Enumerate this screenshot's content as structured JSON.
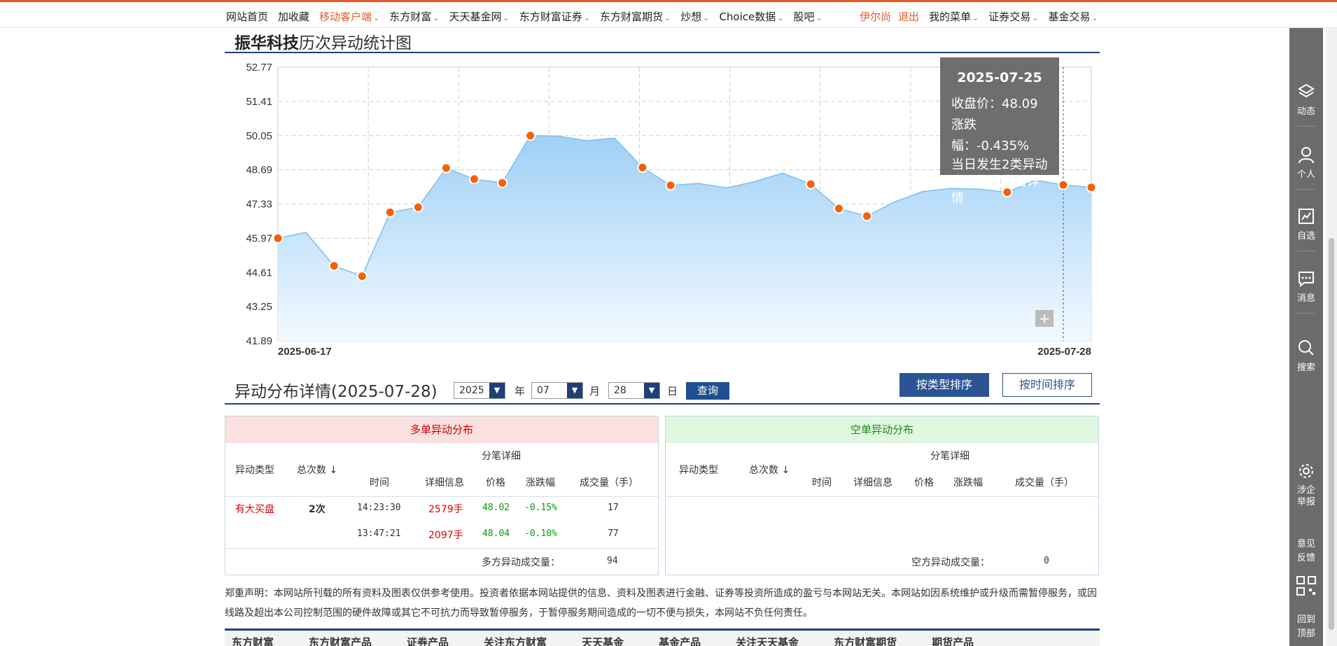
{
  "nav": {
    "left": [
      {
        "label": "网站首页",
        "orange": false,
        "caret": false
      },
      {
        "label": "加收藏",
        "orange": false,
        "caret": false
      },
      {
        "label": "移动客户端",
        "orange": true,
        "caret": true
      },
      {
        "label": "东方财富",
        "orange": false,
        "caret": true
      },
      {
        "label": "天天基金网",
        "orange": false,
        "caret": true
      },
      {
        "label": "东方财富证券",
        "orange": false,
        "caret": true
      },
      {
        "label": "东方财富期货",
        "orange": false,
        "caret": true
      },
      {
        "label": "炒想",
        "orange": false,
        "caret": true
      },
      {
        "label": "Choice数据",
        "orange": false,
        "caret": true
      },
      {
        "label": "股吧",
        "orange": false,
        "caret": true
      }
    ],
    "user": "伊尔尚",
    "logout": "退出",
    "right": [
      {
        "label": "我的菜单",
        "caret": true
      },
      {
        "label": "证券交易",
        "caret": true
      },
      {
        "label": "基金交易",
        "caret": true
      }
    ]
  },
  "section1": {
    "stock_name": "振华科技",
    "title_suffix": "历次异动统计图"
  },
  "tooltip": {
    "date": "2025-07-25",
    "close": "收盘价：48.09",
    "change": "涨跌幅：-0.435%",
    "note1": "当日发生2类异动",
    "note2": "点击圆点查看详情"
  },
  "chart_data": {
    "type": "area",
    "y_ticks": [
      "52.77",
      "51.41",
      "50.05",
      "48.69",
      "47.33",
      "45.97",
      "44.61",
      "43.25",
      "41.89"
    ],
    "ylim": [
      41.89,
      52.77
    ],
    "x_start_label": "2025-06-17",
    "x_end_label": "2025-07-28",
    "grid": true,
    "series": [
      {
        "values": [
          45.97,
          46.2,
          44.87,
          44.46,
          47.0,
          47.2,
          48.76,
          48.32,
          48.17,
          50.05,
          50.03,
          49.85,
          49.95,
          48.78,
          48.07,
          48.15,
          47.97,
          48.22,
          48.56,
          48.12,
          47.15,
          46.85,
          47.42,
          47.83,
          47.95,
          47.92,
          47.8,
          48.28,
          48.09,
          47.99
        ],
        "markers": [
          0,
          2,
          3,
          4,
          5,
          6,
          7,
          8,
          9,
          13,
          14,
          19,
          20,
          21,
          26,
          28,
          29
        ]
      }
    ]
  },
  "section2": {
    "title": "异动分布详情(2025-07-28)",
    "year": "2025",
    "year_unit": "年",
    "month": "07",
    "month_unit": "月",
    "day": "28",
    "day_unit": "日",
    "query": "查询",
    "sort_type": "按类型排序",
    "sort_time": "按时间排序"
  },
  "long_table": {
    "title": "多单异动分布",
    "col_type": "异动类型",
    "col_count": "总次数",
    "col_detail": "分笔详细",
    "col_time": "时间",
    "col_info": "详细信息",
    "col_price": "价格",
    "col_change": "涨跌幅",
    "col_volume": "成交量（手）",
    "type": "有大买盘",
    "count": "2次",
    "rows": [
      {
        "time": "14:23:30",
        "info": "2579手",
        "price": "48.02",
        "change": "-0.15%",
        "volume": "17"
      },
      {
        "time": "13:47:21",
        "info": "2097手",
        "price": "48.04",
        "change": "-0.10%",
        "volume": "77"
      }
    ],
    "total_label": "多方异动成交量：",
    "total_value": "94"
  },
  "short_table": {
    "title": "空单异动分布",
    "col_type": "异动类型",
    "col_count": "总次数",
    "col_detail": "分笔详细",
    "col_time": "时间",
    "col_info": "详细信息",
    "col_price": "价格",
    "col_change": "涨跌幅",
    "col_volume": "成交量（手）",
    "total_label": "空方异动成交量：",
    "total_value": "0"
  },
  "disclaimer": "郑重声明：本网站所刊载的所有资料及图表仅供参考使用。投资者依据本网站提供的信息、资料及图表进行金融、证券等投资所造成的盈亏与本网站无关。本网站如因系统维护或升级而需暂停服务，或因线路及超出本公司控制范围的硬件故障或其它不可抗力而导致暂停服务，于暂停服务期间造成的一切不便与损失，本网站不负任何责任。",
  "footer": [
    "东方财富",
    "东方财富产品",
    "证券产品",
    "关注东方财富",
    "天天基金",
    "基金产品",
    "关注天天基金",
    "东方财富期货",
    "期货产品"
  ],
  "sidebar": {
    "dynamic": "动态",
    "personal": "个人",
    "watchlist": "自选",
    "messages": "消息",
    "search": "搜索",
    "report_1": "涉企",
    "report_2": "举报",
    "feedback_1": "意见",
    "feedback_2": "反馈",
    "top_1": "回到",
    "top_2": "顶部"
  }
}
